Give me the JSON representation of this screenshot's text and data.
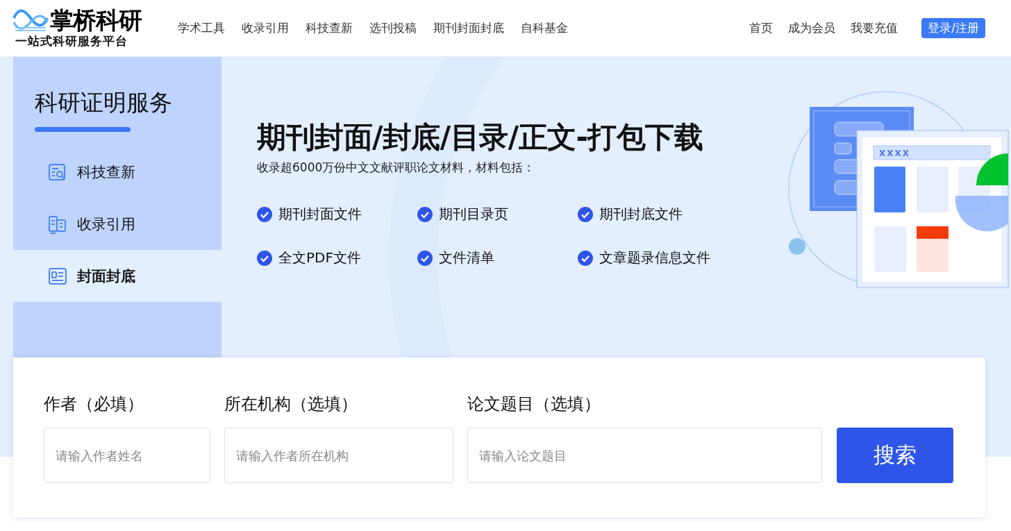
{
  "logo": {
    "name": "掌桥科研",
    "tagline": "一站式科研服务平台"
  },
  "nav": [
    "学术工具",
    "收录引用",
    "科技查新",
    "选刊投稿",
    "期刊封面封底",
    "自科基金"
  ],
  "user_nav": [
    "首页",
    "成为会员",
    "我要充值"
  ],
  "login_button": "登录/注册",
  "sidebar": {
    "title": "科研证明服务",
    "items": [
      {
        "label": "科技查新",
        "kind": "search",
        "selected": false
      },
      {
        "label": "收录引用",
        "kind": "book",
        "selected": false
      },
      {
        "label": "封面封底",
        "kind": "card",
        "selected": true
      }
    ]
  },
  "hero": {
    "title": "期刊封面/封底/目录/正文-打包下载",
    "subtitle": "收录超6000万份中文文献评职论文材料，材料包括：",
    "features": [
      "期刊封面文件",
      "期刊目录页",
      "期刊封底文件",
      "全文PDF文件",
      "文件清单",
      "文章题录信息文件"
    ],
    "illustration_label": "XXXX"
  },
  "search_form": {
    "fields": [
      {
        "label": "作者（必填）",
        "placeholder": "请输入作者姓名"
      },
      {
        "label": "所在机构（选填）",
        "placeholder": "请输入作者所在机构"
      },
      {
        "label": "论文题目（选填）",
        "placeholder": "请输入论文题目"
      }
    ],
    "button": "搜索"
  }
}
